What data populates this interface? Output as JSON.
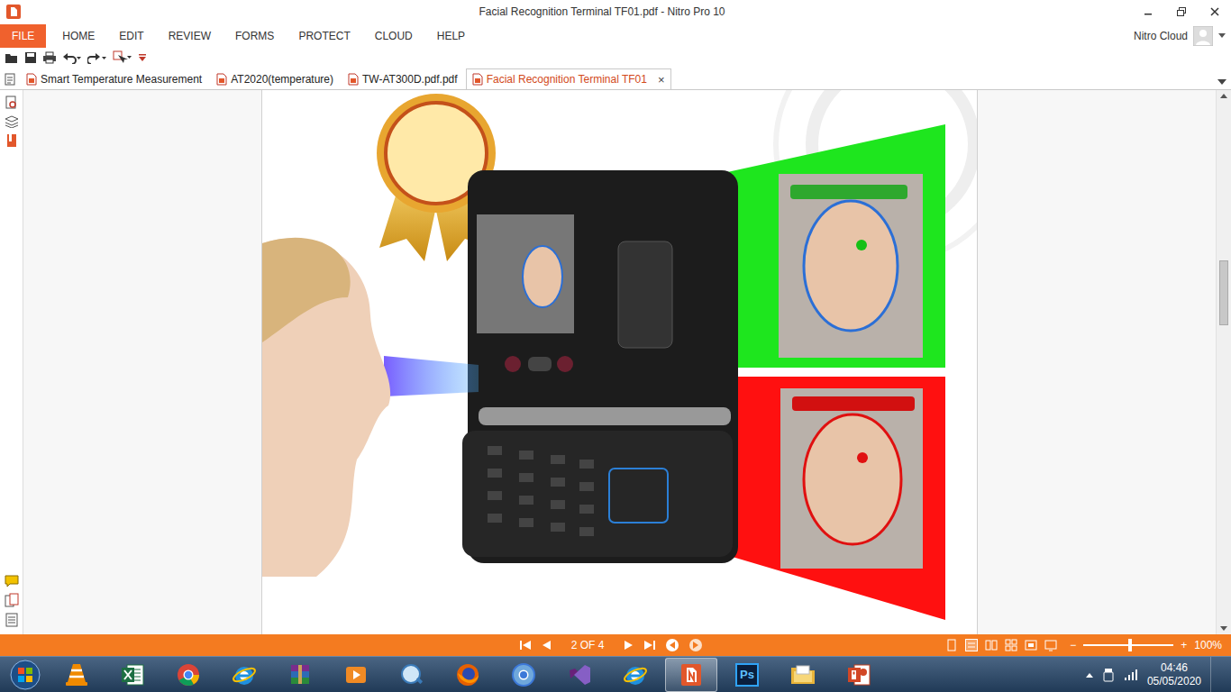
{
  "window": {
    "title": "Facial Recognition Terminal TF01.pdf - Nitro Pro 10"
  },
  "menu": {
    "file": "FILE",
    "items": [
      "HOME",
      "EDIT",
      "REVIEW",
      "FORMS",
      "PROTECT",
      "CLOUD",
      "HELP"
    ]
  },
  "account": {
    "label": "Nitro Cloud"
  },
  "tabs": [
    {
      "label": "Smart Temperature Measurement",
      "selected": false
    },
    {
      "label": "AT2020(temperature)",
      "selected": false
    },
    {
      "label": "TW-AT300D.pdf.pdf",
      "selected": false
    },
    {
      "label": "Facial Recognition Terminal TF01",
      "selected": true,
      "close": "×"
    }
  ],
  "status_bar": {
    "page": "2 OF 4",
    "zoom": "100%",
    "zoom_level": 0.52,
    "zoom_minus": "−",
    "zoom_plus": "+"
  },
  "taskbar": {
    "apps": [
      {
        "kind": "vlc",
        "selected": false
      },
      {
        "kind": "excel",
        "selected": false
      },
      {
        "kind": "chrome",
        "selected": false
      },
      {
        "kind": "ie",
        "selected": false
      },
      {
        "kind": "winrar",
        "selected": false
      },
      {
        "kind": "media",
        "selected": false
      },
      {
        "kind": "network",
        "selected": false
      },
      {
        "kind": "firefox",
        "selected": false
      },
      {
        "kind": "chromium",
        "selected": false
      },
      {
        "kind": "vs",
        "selected": false
      },
      {
        "kind": "ie",
        "selected": false
      },
      {
        "kind": "nitro",
        "selected": true
      },
      {
        "kind": "photoshop",
        "selected": false,
        "label": "Ps"
      },
      {
        "kind": "explorer",
        "selected": false
      },
      {
        "kind": "powerpoint",
        "selected": false
      }
    ],
    "clock": {
      "time": "04:46",
      "date": "05/05/2020"
    }
  }
}
